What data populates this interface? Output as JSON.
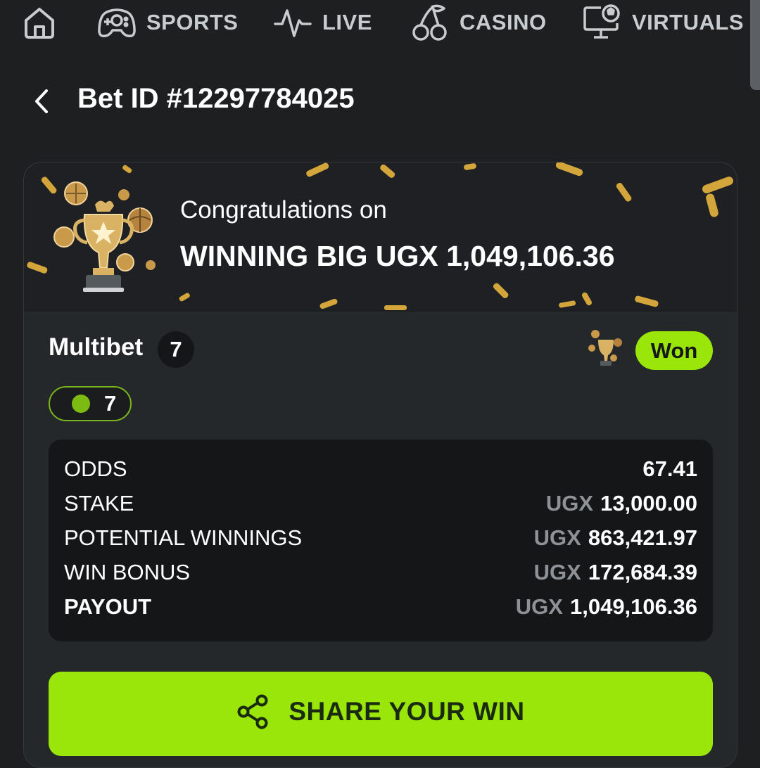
{
  "nav": {
    "items": [
      {
        "icon": "home-icon",
        "label": ""
      },
      {
        "icon": "gamepad-icon",
        "label": "SPORTS"
      },
      {
        "icon": "pulse-icon",
        "label": "LIVE"
      },
      {
        "icon": "cherries-icon",
        "label": "CASINO"
      },
      {
        "icon": "monitor-ball-icon",
        "label": "VIRTUALS"
      }
    ]
  },
  "header": {
    "back_icon": "chevron-left-icon",
    "title": "Bet ID #12297784025"
  },
  "banner": {
    "congrats_text": "Congratulations on",
    "win_text": "WINNING BIG UGX 1,049,106.36"
  },
  "bet": {
    "type_label": "Multibet",
    "selections_count": "7",
    "status": "Won",
    "legs_won": "7"
  },
  "summary": {
    "rows": [
      {
        "label": "ODDS",
        "currency": "",
        "value": "67.41"
      },
      {
        "label": "STAKE",
        "currency": "UGX",
        "value": "13,000.00"
      },
      {
        "label": "POTENTIAL WINNINGS",
        "currency": "UGX",
        "value": "863,421.97"
      },
      {
        "label": "WIN BONUS",
        "currency": "UGX",
        "value": "172,684.39"
      },
      {
        "label": "PAYOUT",
        "currency": "UGX",
        "value": "1,049,106.36"
      }
    ]
  },
  "share": {
    "icon": "share-icon",
    "label": "SHARE YOUR WIN"
  },
  "colors": {
    "background": "#1d1f21",
    "card": "#25282b",
    "accent_green": "#9be60a",
    "muted_text": "#8e9296",
    "gold": "#d4a53a"
  }
}
